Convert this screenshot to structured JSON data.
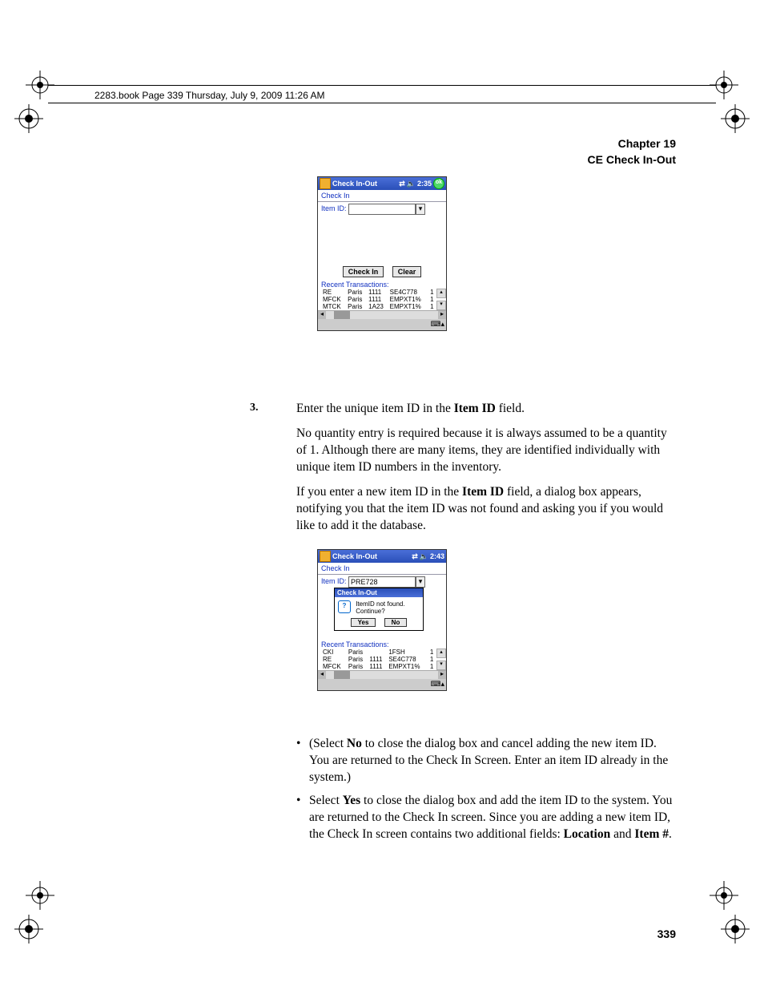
{
  "running_head": "2283.book  Page 339  Thursday, July 9, 2009   11:26 AM",
  "chapter": {
    "line1": "Chapter 19",
    "line2": "CE Check In-Out"
  },
  "step3": {
    "num": "3.",
    "p1a": "Enter the unique item ID in the ",
    "p1b": "Item ID",
    "p1c": " field.",
    "p2": "No quantity entry is required because it is always assumed to be a quantity of 1. Although there are many items, they are identified individually with unique item ID numbers in the inventory.",
    "p3a": "If you enter a new item ID in the ",
    "p3b": "Item ID",
    "p3c": " field, a dialog box appears, notifying you that the item ID was not found and asking you if you would like to add it the database."
  },
  "bullets": {
    "b1a": "(Select ",
    "b1b": "No",
    "b1c": " to close the dialog box and cancel adding the new item ID. You are returned to the Check In Screen. Enter an item ID already in the system.)",
    "b2a": "Select ",
    "b2b": "Yes",
    "b2c": " to close the dialog box and add the item ID to the system. You are returned to the Check In screen. Since you are adding a new item ID, the Check In screen contains two additional fields: ",
    "b2d": "Location",
    "b2e": " and ",
    "b2f": "Item #",
    "b2g": "."
  },
  "page_number": "339",
  "screenshot1": {
    "title": "Check In-Out",
    "time": "2:35",
    "menu": "Check In",
    "item_label": "Item ID:",
    "item_value": "",
    "btn_checkin": "Check In",
    "btn_clear": "Clear",
    "recent_label": "Recent Transactions:",
    "rows": [
      {
        "c1": "RE",
        "c2": "Paris",
        "c3": "1111",
        "c4": "SE4C778",
        "c5": "1"
      },
      {
        "c1": "MFCK",
        "c2": "Paris",
        "c3": "1111",
        "c4": "EMPXT1%",
        "c5": "1"
      },
      {
        "c1": "MTCK",
        "c2": "Paris",
        "c3": "1A23",
        "c4": "EMPXT1%",
        "c5": "1"
      }
    ]
  },
  "screenshot2": {
    "title": "Check In-Out",
    "time": "2:43",
    "menu": "Check In",
    "item_label": "Item ID:",
    "item_value": "PRE728",
    "dlg_title": "Check In-Out",
    "dlg_text": "ItemID not found. Continue?",
    "dlg_yes": "Yes",
    "dlg_no": "No",
    "recent_label": "Recent Transactions:",
    "rows": [
      {
        "c1": "CKI",
        "c2": "Paris",
        "c3": "",
        "c4": "1FSH",
        "c5": "1"
      },
      {
        "c1": "RE",
        "c2": "Paris",
        "c3": "1111",
        "c4": "SE4C778",
        "c5": "1"
      },
      {
        "c1": "MFCK",
        "c2": "Paris",
        "c3": "1111",
        "c4": "EMPXT1%",
        "c5": "1"
      }
    ]
  }
}
